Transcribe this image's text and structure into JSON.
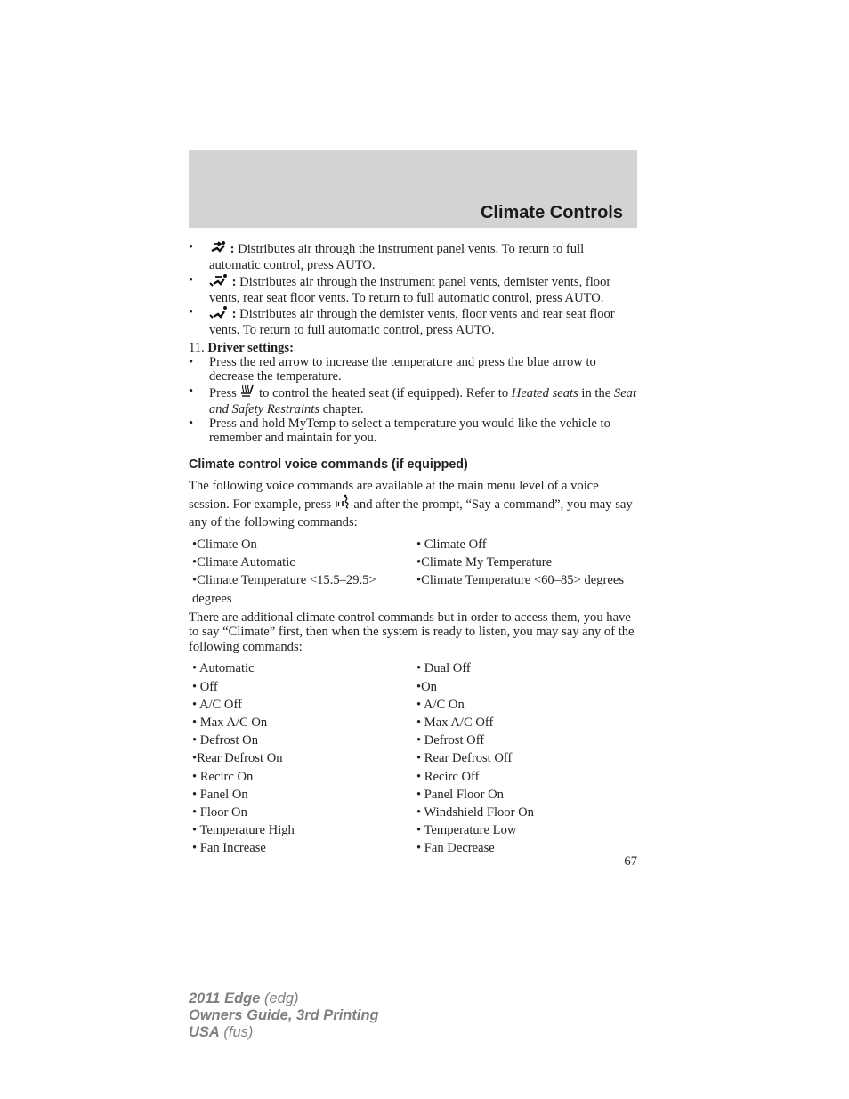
{
  "header": {
    "title": "Climate Controls"
  },
  "airflow_bullets": [
    {
      "icon": "panel-vent-icon",
      "separator": ":",
      "text": " Distributes air through the instrument panel vents. To return to full automatic control, press AUTO."
    },
    {
      "icon": "panel-floor-demister-vent-icon",
      "separator": ":",
      "text": " Distributes air through the instrument panel vents, demister vents, floor vents, rear seat floor vents. To return to full automatic control, press AUTO."
    },
    {
      "icon": "demister-floor-vent-icon",
      "separator": ":",
      "text": " Distributes air through the demister vents, floor vents and rear seat floor vents. To return to full automatic control, press AUTO."
    }
  ],
  "driver_settings": {
    "number": "11.",
    "title": "Driver settings:",
    "bullets": {
      "b1": "Press the red arrow to increase the temperature and press the blue arrow to decrease the temperature.",
      "b2_pre": "Press",
      "b2_icon": "heated-seat-icon",
      "b2_mid": " to control the heated seat (if equipped). Refer to ",
      "b2_italic1": "Heated seats",
      "b2_mid2": " in the ",
      "b2_italic2": "Seat and Safety Restraints",
      "b2_post": " chapter.",
      "b3": "Press and hold MyTemp to select a temperature you would like the vehicle to remember and maintain for you."
    }
  },
  "voice_section": {
    "title": "Climate control voice commands (if equipped)",
    "intro_pre": "The following voice commands are available at the main menu level of a voice session. For example, press ",
    "intro_icon": "voice-button-icon",
    "intro_post": " and after the prompt, “Say a command”, you may say any of the following commands:",
    "main_commands": [
      [
        "•Climate On",
        "• Climate Off"
      ],
      [
        "•Climate Automatic",
        "•Climate My Temperature"
      ],
      [
        "•Climate Temperature <15.5–29.5> degrees",
        "•Climate Temperature <60–85> degrees"
      ]
    ],
    "additional_intro": "There are additional climate control commands but in order to access them, you have to say “Climate” first, then when the system is ready to listen, you may say any of the following commands:",
    "additional_commands": [
      [
        "• Automatic",
        "• Dual Off"
      ],
      [
        "• Off",
        "•On"
      ],
      [
        "• A/C Off",
        "• A/C On"
      ],
      [
        "• Max A/C On",
        "• Max A/C Off"
      ],
      [
        "• Defrost On",
        "• Defrost Off"
      ],
      [
        "•Rear Defrost On",
        "• Rear Defrost Off"
      ],
      [
        "• Recirc On",
        "• Recirc Off"
      ],
      [
        "• Panel On",
        "• Panel Floor On"
      ],
      [
        "• Floor On",
        "• Windshield Floor On"
      ],
      [
        "• Temperature High",
        "• Temperature Low"
      ],
      [
        "• Fan Increase",
        "• Fan Decrease"
      ]
    ]
  },
  "page_number": "67",
  "footer": {
    "line1_bold": "2011 Edge",
    "line1_light": " (edg)",
    "line2": "Owners Guide, 3rd Printing",
    "line3_bold": "USA",
    "line3_light": " (fus)"
  }
}
